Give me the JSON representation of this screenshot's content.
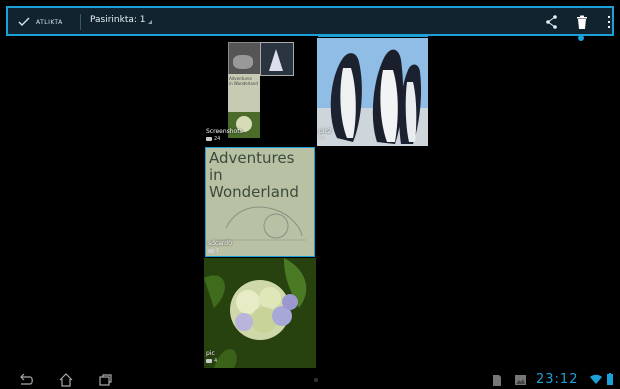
{
  "action_bar": {
    "done_label": "ATLIKTA",
    "selection_label": "Pasirinkta: 1"
  },
  "albums": [
    {
      "name": "Screenshots",
      "count": "24"
    },
    {
      "name": "pic2",
      "count": ""
    },
    {
      "name": "sdcard0",
      "count": "1"
    },
    {
      "name": "pic",
      "count": "4"
    }
  ],
  "album_text": {
    "sdcard_preview_line1": "Adventures",
    "sdcard_preview_line2": "in Wonderland"
  },
  "status_bar": {
    "clock": "23:12"
  },
  "colors": {
    "accent": "#1ba1d8",
    "action_bar_bg": "#10232e"
  }
}
